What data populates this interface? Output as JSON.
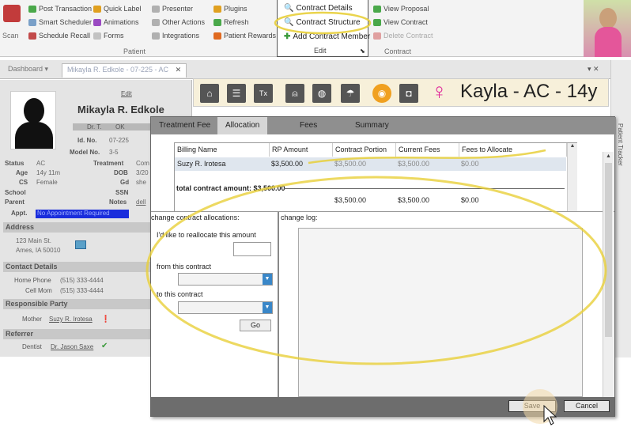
{
  "ribbon": {
    "patient_group": {
      "items": [
        "Post Transaction",
        "Smart Scheduler",
        "Schedule Recall",
        "Quick Label",
        "Animations",
        "Forms",
        "Presenter",
        "Other Actions",
        "Integrations",
        "Plugins",
        "Refresh",
        "Patient Rewards"
      ],
      "label": "Patient",
      "scan_label": "Scan"
    },
    "edit_group": {
      "items": [
        "Contract Details",
        "Contract Structure",
        "Add Contract Member"
      ],
      "label": "Edit"
    },
    "contract_group": {
      "items": [
        "View Proposal",
        "View Contract",
        "Delete Contract"
      ],
      "label": "Contract"
    }
  },
  "tabs": {
    "dashboard": "Dashboard",
    "patient_tab": "Mikayla R. Edkole - 07-225 - AC",
    "sidebar_label": "Patient Tracker"
  },
  "patient": {
    "edit_link": "Edit",
    "name": "Mikayla R. Edkole",
    "dr": "Dr. T.",
    "ok_label": "OK",
    "id_label": "Id. No.",
    "id_value": "07-225",
    "model_label": "Model No.",
    "model_value": "3-5",
    "status_label": "Status",
    "status_value": "AC",
    "treatment_label": "Treatment",
    "treatment_value": "Com",
    "age_label": "Age",
    "age_value": "14y 11m",
    "dob_label": "DOB",
    "dob_value": "3/20",
    "cs_label": "CS",
    "cs_value": "Female",
    "gd_label": "Gd",
    "gd_value": "she",
    "school_label": "School",
    "ssn_label": "SSN",
    "parent_label": "Parent",
    "notes_label": "Notes",
    "notes_value": "dell",
    "appt_label": "Appt.",
    "appt_value": "No Appointment Required"
  },
  "sections": {
    "address_head": "Address",
    "address_line1": "123 Main St.",
    "address_line2": "Ames, IA 50010",
    "contact_head": "Contact Details",
    "home_phone_label": "Home Phone",
    "home_phone": "(515) 333-4444",
    "cell_label": "Cell Mom",
    "cell_phone": "(515) 333-4444",
    "responsible_head": "Responsible Party",
    "mother_label": "Mother",
    "mother_value": "Suzy R. Irotesa",
    "referrer_head": "Referrer",
    "dentist_label": "Dentist",
    "dentist_value": "Dr. Jason Saxe"
  },
  "header_strip": {
    "patient_heading": "Kayla - AC - 14y",
    "icons": [
      "home-icon",
      "document-icon",
      "tx-icon",
      "tooth-icon",
      "globe-icon",
      "umbrella-icon",
      "coin-icon",
      "camera-icon"
    ]
  },
  "dialog": {
    "tabs": [
      "Treatment Fee",
      "Allocation",
      "Fees",
      "Summary"
    ],
    "active_tab": "Allocation",
    "grid": {
      "headers": [
        "Billing Name",
        "RP Amount",
        "Contract Portion",
        "Current Fees",
        "Fees to Allocate"
      ],
      "row": [
        "Suzy R. Irotesa",
        "$3,500.00",
        "$3,500.00",
        "$3,500.00",
        "$0.00"
      ],
      "total_label": "total contract amount: $3,500.00",
      "totals": [
        "$3,500.00",
        "$3,500.00",
        "$0.00"
      ]
    },
    "alloc_label": "change contract allocations:",
    "changelog_label": "change log:",
    "reallocate_label": "I'd like to reallocate this amount",
    "from_label": "from this contract",
    "to_label": "to this contract",
    "go_label": "Go",
    "save_label": "Save",
    "cancel_label": "Cancel"
  },
  "colors": {
    "highlight_ring": "#e8cf3a",
    "accent_pink": "#e0299a",
    "appt_blue": "#1a2ddc"
  }
}
